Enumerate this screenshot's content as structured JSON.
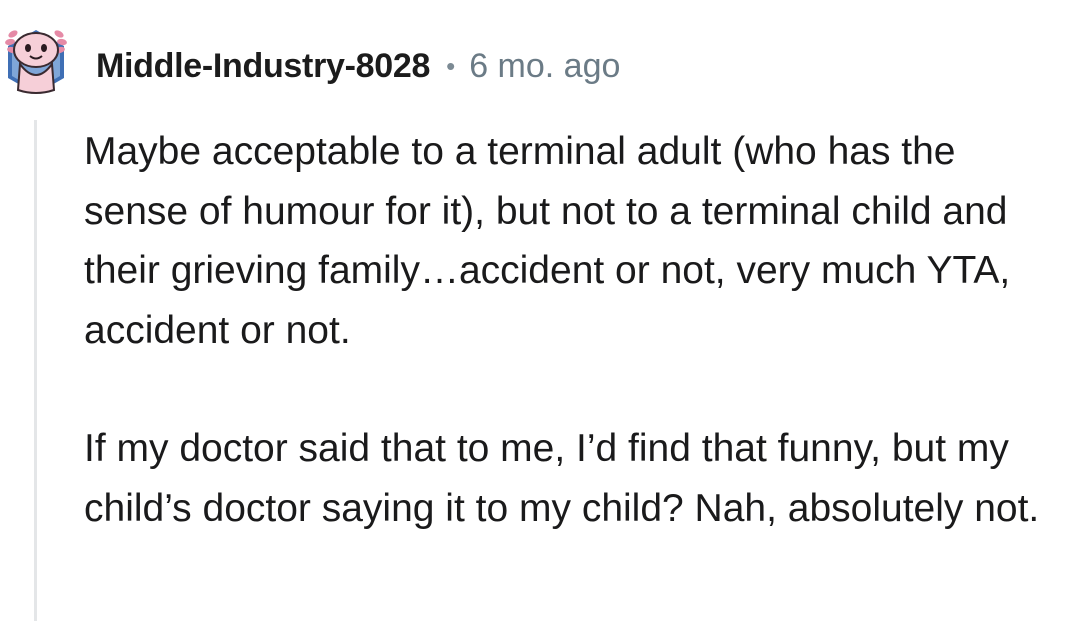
{
  "comment": {
    "author": "Middle-Industry-8028",
    "separator": "•",
    "timestamp": "6 mo. ago",
    "avatar_icon": "axolotl-avatar-icon",
    "paragraphs": [
      "Maybe acceptable to a terminal adult (who has the sense of humour for it), but not to a terminal child and their grieving family…accident or not, very much YTA, accident or not.",
      "If my doctor said that to me, I’d find that funny, but my child’s doctor saying it to my child? Nah, absolutely not."
    ]
  },
  "colors": {
    "text": "#1a1a1b",
    "meta": "#6b7b86",
    "thread_line": "#e4e6e8",
    "avatar_bg": "#3f6fb5",
    "avatar_creature": "#f6cfd8"
  }
}
